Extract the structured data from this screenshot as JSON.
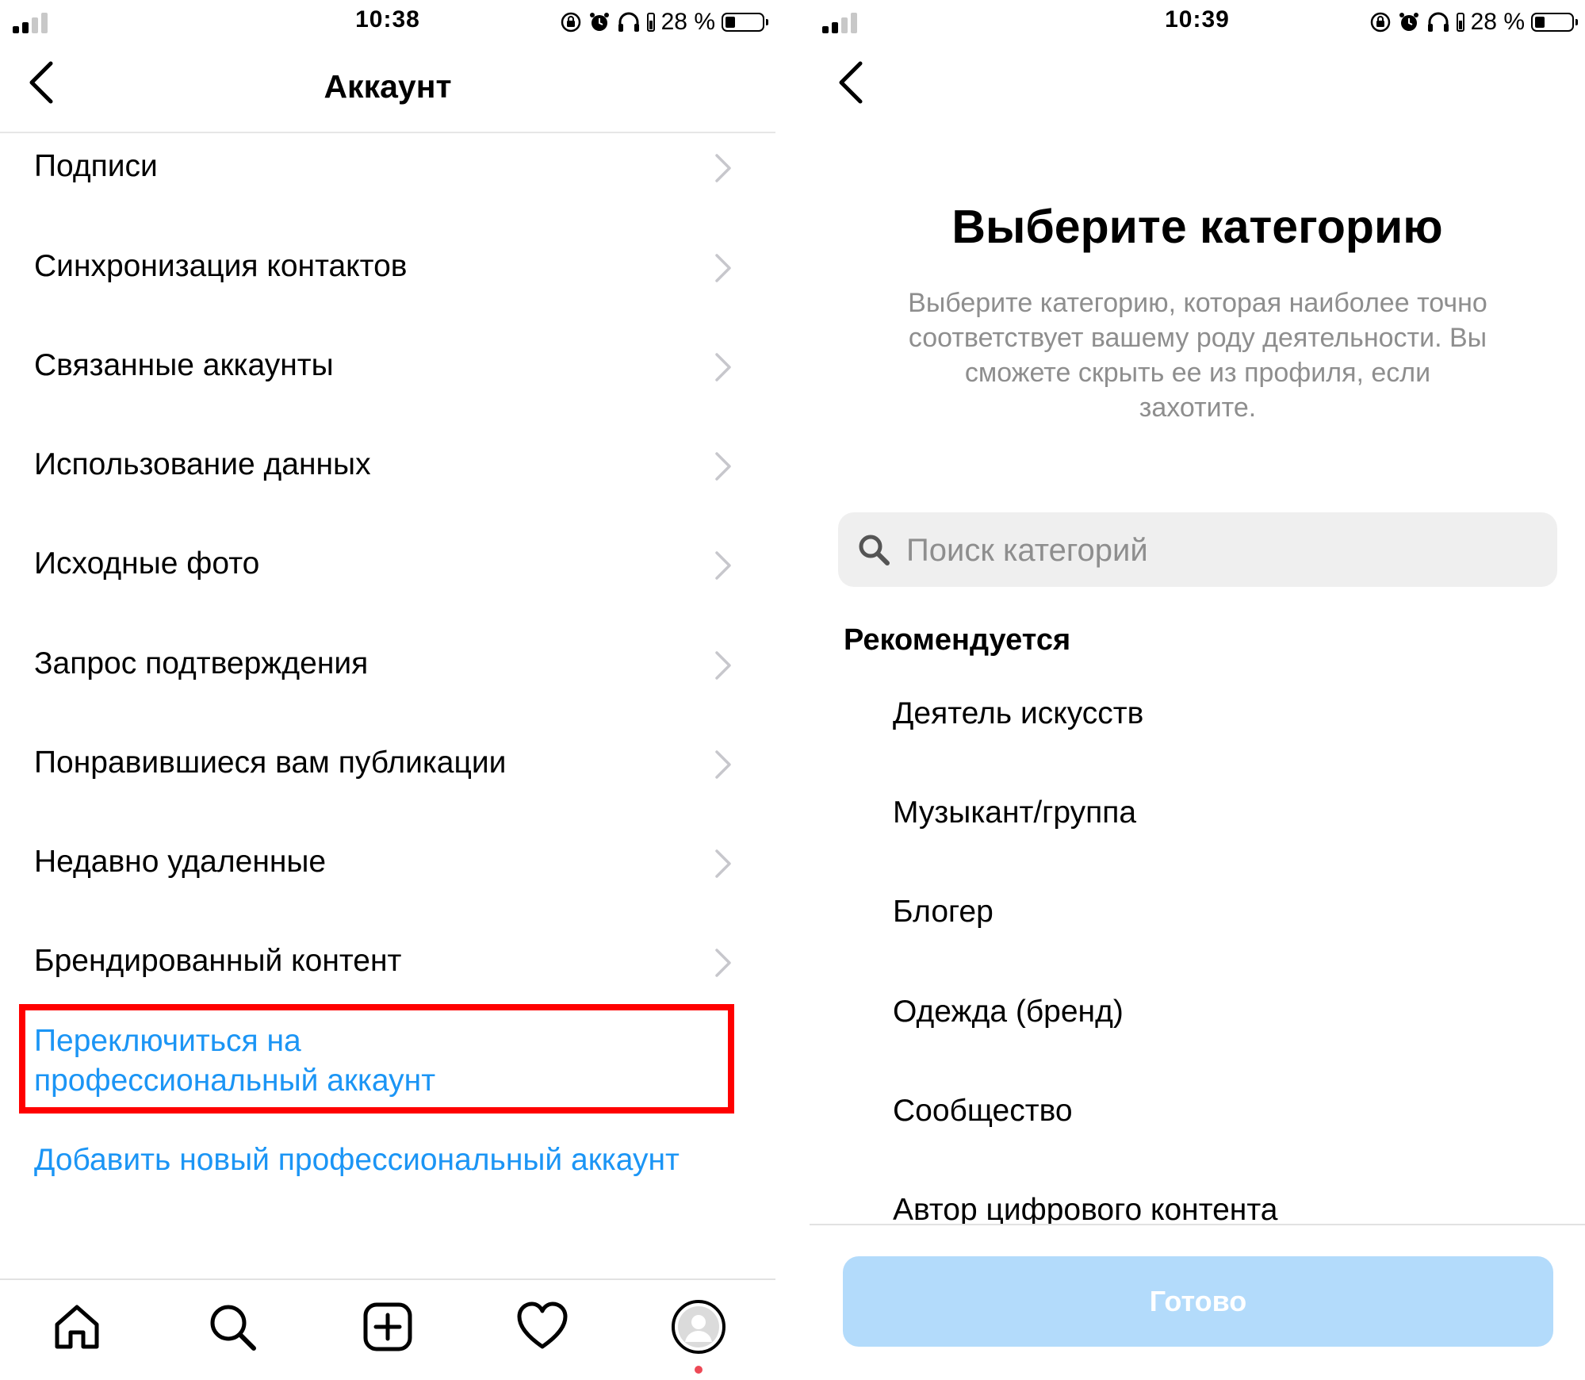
{
  "left": {
    "status": {
      "time": "10:38",
      "battery": "28 %",
      "battery_level_percent": 28,
      "signal_bars_active": 2
    },
    "header": {
      "title": "Аккаунт"
    },
    "menu": [
      {
        "label": "Подписи"
      },
      {
        "label": "Синхронизация контактов"
      },
      {
        "label": "Связанные аккаунты"
      },
      {
        "label": "Использование данных"
      },
      {
        "label": "Исходные фото"
      },
      {
        "label": "Запрос подтверждения"
      },
      {
        "label": "Понравившиеся вам публикации"
      },
      {
        "label": "Недавно удаленные"
      },
      {
        "label": "Брендированный контент"
      }
    ],
    "switch_link": {
      "line1": "Переключиться на",
      "line2": "профессиональный аккаунт"
    },
    "add_link": "Добавить новый профессиональный аккаунт",
    "tabbar": [
      "home-icon",
      "search-icon",
      "new-post-icon",
      "activity-heart-icon",
      "profile-avatar-icon"
    ],
    "colors": {
      "link": "#1b95f5",
      "highlight": "#ff0000",
      "notification_dot": "#ed4956"
    }
  },
  "right": {
    "status": {
      "time": "10:39",
      "battery": "28 %",
      "battery_level_percent": 28,
      "signal_bars_active": 2
    },
    "title": "Выберите категорию",
    "description": "Выберите категорию, которая наиболее точно соответствует вашему роду деятельности. Вы сможете скрыть ее из профиля, если захотите.",
    "search": {
      "placeholder": "Поиск категорий",
      "value": ""
    },
    "section": "Рекомендуется",
    "categories": [
      "Деятель искусств",
      "Музыкант/группа",
      "Блогер",
      "Одежда (бренд)",
      "Сообщество",
      "Автор цифрового контента"
    ],
    "done_label": "Готово",
    "colors": {
      "done_button": "#b3dbfb",
      "search_bg": "#efefef",
      "muted_text": "#8e8e8e"
    }
  }
}
